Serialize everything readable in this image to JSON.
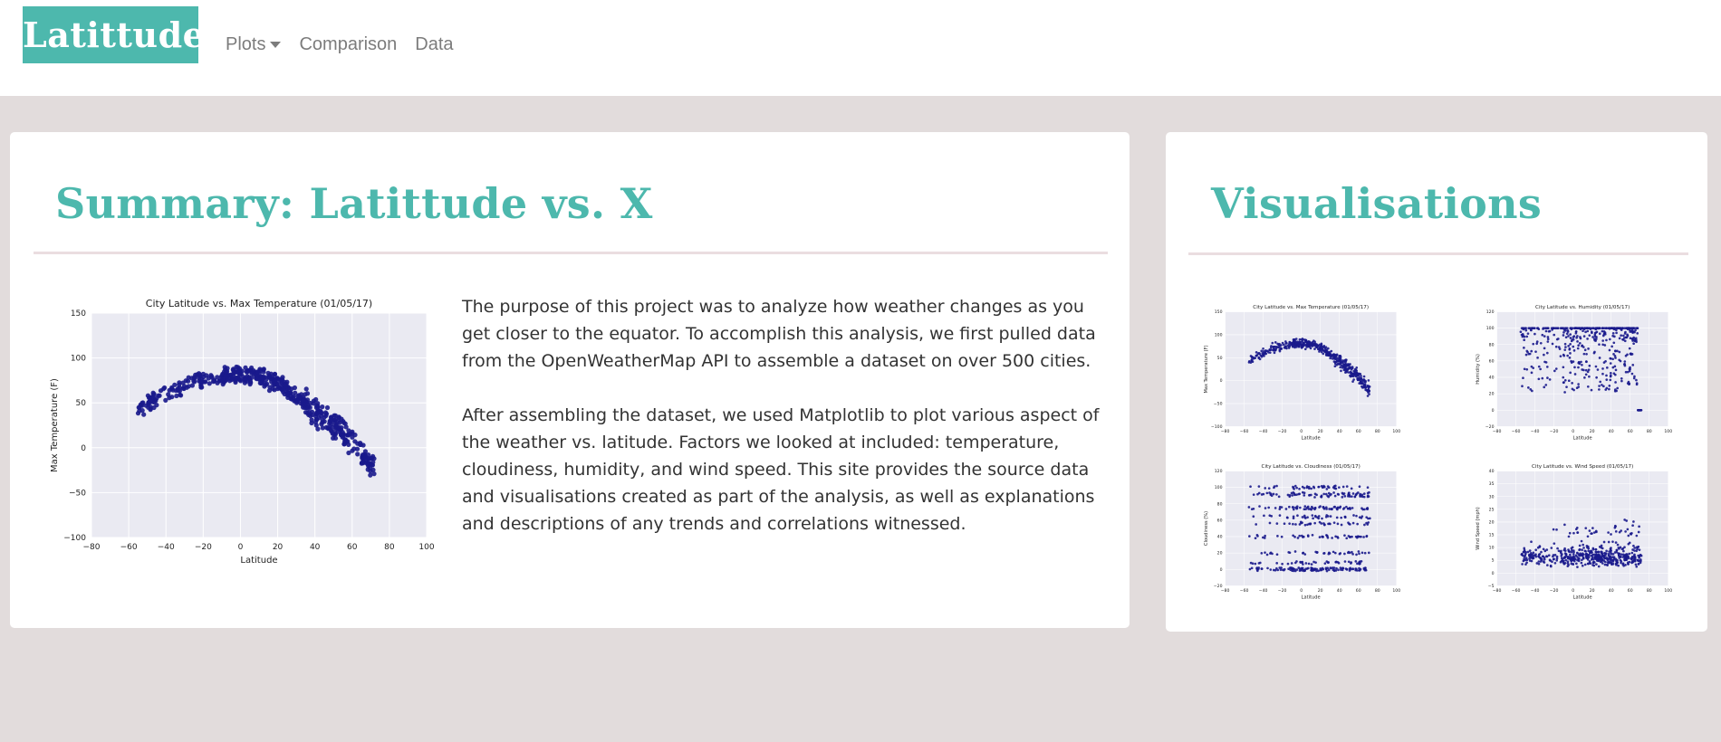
{
  "navbar": {
    "brand": "Latittude",
    "links": [
      {
        "label": "Plots",
        "dropdown": true
      },
      {
        "label": "Comparison",
        "dropdown": false
      },
      {
        "label": "Data",
        "dropdown": false
      }
    ]
  },
  "summary": {
    "title": "Summary: Latittude vs. X",
    "paragraphs": [
      "The purpose of this project was to analyze how weather changes as you get closer to the equator. To accomplish this analysis, we first pulled data from the OpenWeatherMap API to assemble a dataset on over 500 cities.",
      "After assembling the dataset, we used Matplotlib to plot various aspect of the weather vs. latitude. Factors we looked at included: temperature, cloudiness, humidity, and wind speed. This site provides the source data and visualisations created as part of the analysis, as well as explanations and descriptions of any trends and correlations witnessed."
    ]
  },
  "visualisations": {
    "title": "Visualisations"
  },
  "colors": {
    "accent": "#4db8ad",
    "background": "#e2dcdc",
    "plot_bg": "#eaeaf2",
    "marker": "#1a1a8c"
  },
  "chart_data": [
    {
      "type": "scatter",
      "title": "City Latitude vs. Max Temperature (01/05/17)",
      "xlabel": "Latitude",
      "ylabel": "Max Temperature (F)",
      "xlim": [
        -80,
        100
      ],
      "ylim": [
        -100,
        150
      ],
      "xticks": [
        "−80",
        "−60",
        "−40",
        "−20",
        "0",
        "20",
        "40",
        "60",
        "80",
        "100"
      ],
      "yticks": [
        "−100",
        "−50",
        "0",
        "50",
        "100",
        "150"
      ],
      "grid": true,
      "trend": [
        [
          -55,
          42
        ],
        [
          -40,
          62
        ],
        [
          -25,
          74
        ],
        [
          -10,
          80
        ],
        [
          0,
          82
        ],
        [
          10,
          80
        ],
        [
          20,
          72
        ],
        [
          30,
          58
        ],
        [
          40,
          42
        ],
        [
          50,
          25
        ],
        [
          60,
          8
        ],
        [
          70,
          -18
        ]
      ],
      "spread": 14
    },
    {
      "type": "scatter",
      "title": "City Latitude vs. Max Temperature (01/05/17)",
      "xlabel": "Latitude",
      "ylabel": "Max Temperature (F)",
      "xlim": [
        -80,
        100
      ],
      "ylim": [
        -100,
        150
      ],
      "xticks": [
        "−80",
        "−60",
        "−40",
        "−20",
        "0",
        "20",
        "40",
        "60",
        "80",
        "100"
      ],
      "yticks": [
        "−100",
        "−50",
        "0",
        "50",
        "100",
        "150"
      ],
      "grid": true,
      "trend": [
        [
          -55,
          42
        ],
        [
          -40,
          62
        ],
        [
          -25,
          74
        ],
        [
          -10,
          80
        ],
        [
          0,
          82
        ],
        [
          10,
          80
        ],
        [
          20,
          72
        ],
        [
          30,
          58
        ],
        [
          40,
          42
        ],
        [
          50,
          25
        ],
        [
          60,
          8
        ],
        [
          70,
          -18
        ]
      ],
      "spread": 14
    },
    {
      "type": "scatter",
      "title": "City Latitude vs. Humidity (01/05/17)",
      "xlabel": "Latitude",
      "ylabel": "Humidity (%)",
      "xlim": [
        -80,
        100
      ],
      "ylim": [
        -20,
        120
      ],
      "xticks": [
        "−80",
        "−60",
        "−40",
        "−20",
        "0",
        "20",
        "40",
        "60",
        "80",
        "100"
      ],
      "yticks": [
        "−20",
        "0",
        "20",
        "40",
        "60",
        "80",
        "100",
        "120"
      ],
      "grid": true,
      "pattern": "humidity"
    },
    {
      "type": "scatter",
      "title": "City Latitude vs. Cloudiness (01/05/17)",
      "xlabel": "Latitude",
      "ylabel": "Cloudiness (%)",
      "xlim": [
        -80,
        100
      ],
      "ylim": [
        -20,
        120
      ],
      "xticks": [
        "−80",
        "−60",
        "−40",
        "−20",
        "0",
        "20",
        "40",
        "60",
        "80",
        "100"
      ],
      "yticks": [
        "−20",
        "0",
        "20",
        "40",
        "60",
        "80",
        "100",
        "120"
      ],
      "grid": true,
      "pattern": "cloudiness"
    },
    {
      "type": "scatter",
      "title": "City Latitude vs. Wind Speed (01/05/17)",
      "xlabel": "Latitude",
      "ylabel": "Wind Speed (mph)",
      "xlim": [
        -80,
        100
      ],
      "ylim": [
        -5,
        40
      ],
      "xticks": [
        "−80",
        "−60",
        "−40",
        "−20",
        "0",
        "20",
        "40",
        "60",
        "80",
        "100"
      ],
      "yticks": [
        "−5",
        "0",
        "5",
        "10",
        "15",
        "20",
        "25",
        "30",
        "35",
        "40"
      ],
      "grid": true,
      "pattern": "wind"
    }
  ]
}
